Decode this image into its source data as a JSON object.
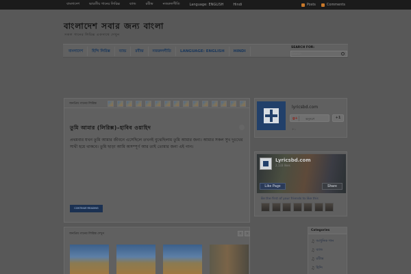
{
  "topbar": {
    "links": [
      "বাংলাদেশ",
      "ভারতীয় গানের লিরিক্স",
      "ব্যান্ড",
      "রবীন্দ্র",
      "নজরুলগীতি",
      "Language: ENGLISH",
      "Hindi"
    ],
    "feeds": [
      {
        "label": "Posts",
        "icon": "rss-icon"
      },
      {
        "label": "Comments",
        "icon": "rss-icon"
      }
    ]
  },
  "header": {
    "title": "বাংলাদেশ সবার জন্য বাংলা",
    "subtitle": "সকল গানের লিরিক্স একসাথে দেখুন"
  },
  "nav": {
    "items": [
      "বাংলাদেশ",
      "হিন্দি লিরিক্স",
      "ব্যান্ড",
      "রবীন্দ্র",
      "নজরুলগীতি",
      "LANGUAGE: ENGLISH",
      "HINDI"
    ],
    "search_label": "SEARCH FOR:",
    "search_placeholder": "Search"
  },
  "post": {
    "header_label": "জনপ্রিয় গানের লিরিক্স",
    "title": "তুমি আমার (লিরিক্স)–হাবিব ওয়াহিদ",
    "body": "প্রথমবার যখন তুমি আমার জীবনে এসেছিলে তখনই বুঝেছিলাম তুমি আমার জন্য। আমার সকল সুখ দুঃখের সাথী হয়ে থাকবে। তুমি ছাড়া আমি অসম্পূর্ণ আর তাই তোমার জন্য এই গান।",
    "continue_label": "CONTINUE READING",
    "thumb_count": 15
  },
  "gplus": {
    "name": "lyricsbd.com",
    "follow_label": "অনুসরণ",
    "plus_label": "+1",
    "count": "+১"
  },
  "facebook": {
    "name": "Lyricsbd.com",
    "likes": "2,133 likes",
    "like_label": "Like Page",
    "share_label": "Share",
    "friends_text": "Be the first of your friends to like this",
    "face_count": 7
  },
  "related": {
    "label": "জনপ্রিয় গানের লিরিক্স দেখুন",
    "prev": "‹",
    "next": "›"
  },
  "categories": {
    "title": "Categories",
    "items": [
      "আধুনিক গান",
      "ব্যান্ড",
      "রবীন্দ্র",
      "হিন্দি"
    ]
  }
}
